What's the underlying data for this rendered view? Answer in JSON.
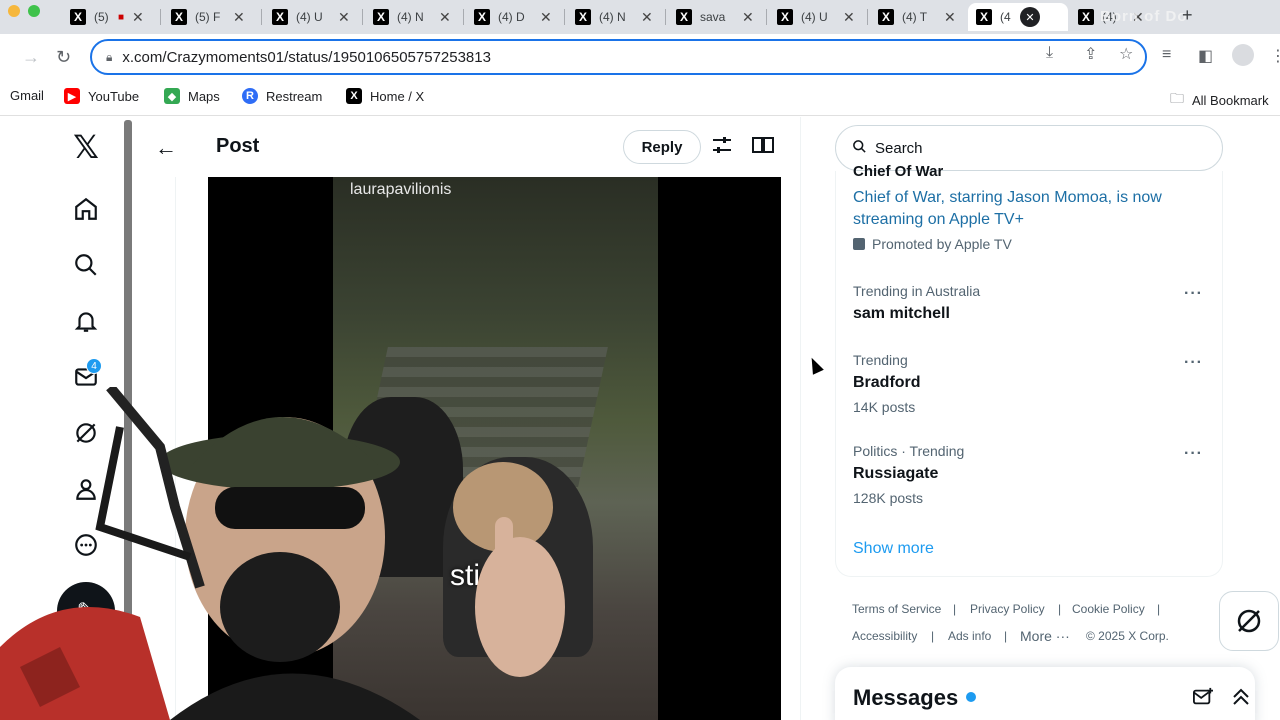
{
  "browser": {
    "tabs": [
      {
        "label": "(5)"
      },
      {
        "label": "(5) F"
      },
      {
        "label": "(4) U"
      },
      {
        "label": "(4) N"
      },
      {
        "label": "(4) D"
      },
      {
        "label": "(4) N"
      },
      {
        "label": "sava"
      },
      {
        "label": "(4) U"
      },
      {
        "label": "(4) T"
      },
      {
        "label": "(4"
      },
      {
        "label": "(4)"
      }
    ],
    "url": "x.com/Crazymoments01/status/1950106505757253813",
    "bookmarks": [
      {
        "label": "Gmail"
      },
      {
        "label": "YouTube"
      },
      {
        "label": "Maps"
      },
      {
        "label": "Restream"
      },
      {
        "label": "Home / X"
      }
    ],
    "all_bookmarks": "All Bookmark",
    "watermark": "Born of Do"
  },
  "header": {
    "title": "Post",
    "reply_label": "Reply"
  },
  "nav": {
    "message_badge": "4"
  },
  "video": {
    "username": "laurapavilionis",
    "caption": "sticks"
  },
  "search": {
    "placeholder": "Search"
  },
  "promo": {
    "title_cut": "Chief Of War",
    "description": "Chief of War, starring Jason Momoa, is now streaming on Apple TV+",
    "promoted_by": "Promoted by Apple TV"
  },
  "trends": [
    {
      "category": "Trending in Australia",
      "name": "sam mitchell",
      "count": ""
    },
    {
      "category": "Trending",
      "name": "Bradford",
      "count": "14K posts"
    },
    {
      "category": "Politics · Trending",
      "name": "Russiagate",
      "count": "128K posts"
    }
  ],
  "show_more": "Show more",
  "footer": {
    "terms": "Terms of Service",
    "privacy": "Privacy Policy",
    "cookie": "Cookie Policy",
    "accessibility": "Accessibility",
    "ads": "Ads info",
    "more": "More ···",
    "copyright": "© 2025 X Corp."
  },
  "messages": {
    "title": "Messages"
  },
  "colors": {
    "accent": "#1d9bf0",
    "text": "#0f1419",
    "muted": "#536471",
    "omnibox_border": "#1a73e8"
  }
}
